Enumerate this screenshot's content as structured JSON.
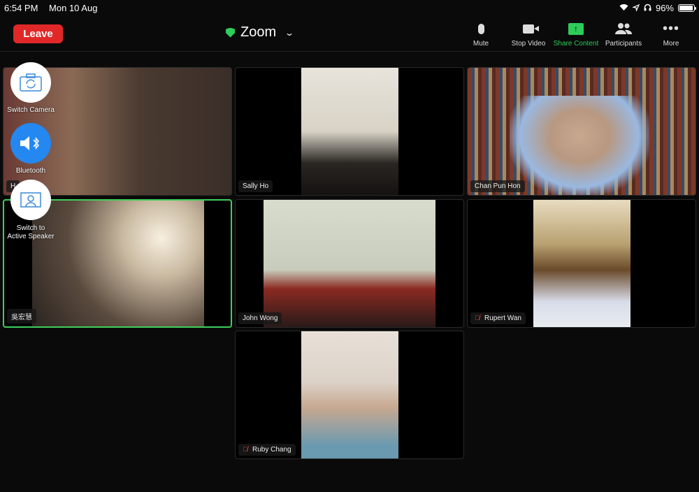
{
  "status_bar": {
    "time": "6:54 PM",
    "date": "Mon 10 Aug",
    "battery": "96%",
    "battery_level": 0.96,
    "icons": [
      "wifi-icon",
      "location-icon",
      "headphones-icon",
      "battery-icon"
    ]
  },
  "toolbar": {
    "leave_label": "Leave",
    "meeting_title": "Zoom",
    "buttons": [
      {
        "label": "Mute",
        "icon": "microphone-icon"
      },
      {
        "label": "Stop Video",
        "icon": "video-camera-icon"
      },
      {
        "label": "Share Content",
        "icon": "share-screen-icon",
        "color": "#2ecc5a"
      },
      {
        "label": "Participants",
        "icon": "participants-icon"
      },
      {
        "label": "More",
        "icon": "more-icon"
      }
    ]
  },
  "floating_controls": {
    "switch_camera": "Switch Camera",
    "bluetooth": "Bluetooth",
    "active_speaker_line1": "Switch to",
    "active_speaker_line2": "Active Speaker"
  },
  "participants": [
    {
      "name": "H",
      "muted": false,
      "active": false
    },
    {
      "name": "Sally Ho",
      "muted": false,
      "active": false
    },
    {
      "name": "Chan Pun Hon",
      "muted": false,
      "active": false
    },
    {
      "name": "吳宏慧",
      "muted": false,
      "active": true
    },
    {
      "name": "John Wong",
      "muted": false,
      "active": false
    },
    {
      "name": "Rupert Wan",
      "muted": true,
      "active": false
    },
    {
      "name": "Ruby Chang",
      "muted": true,
      "active": false
    }
  ],
  "colors": {
    "leave": "#e02828",
    "active_speaker": "#3fcf5a",
    "share": "#2ecc5a",
    "muted": "#e04545"
  }
}
